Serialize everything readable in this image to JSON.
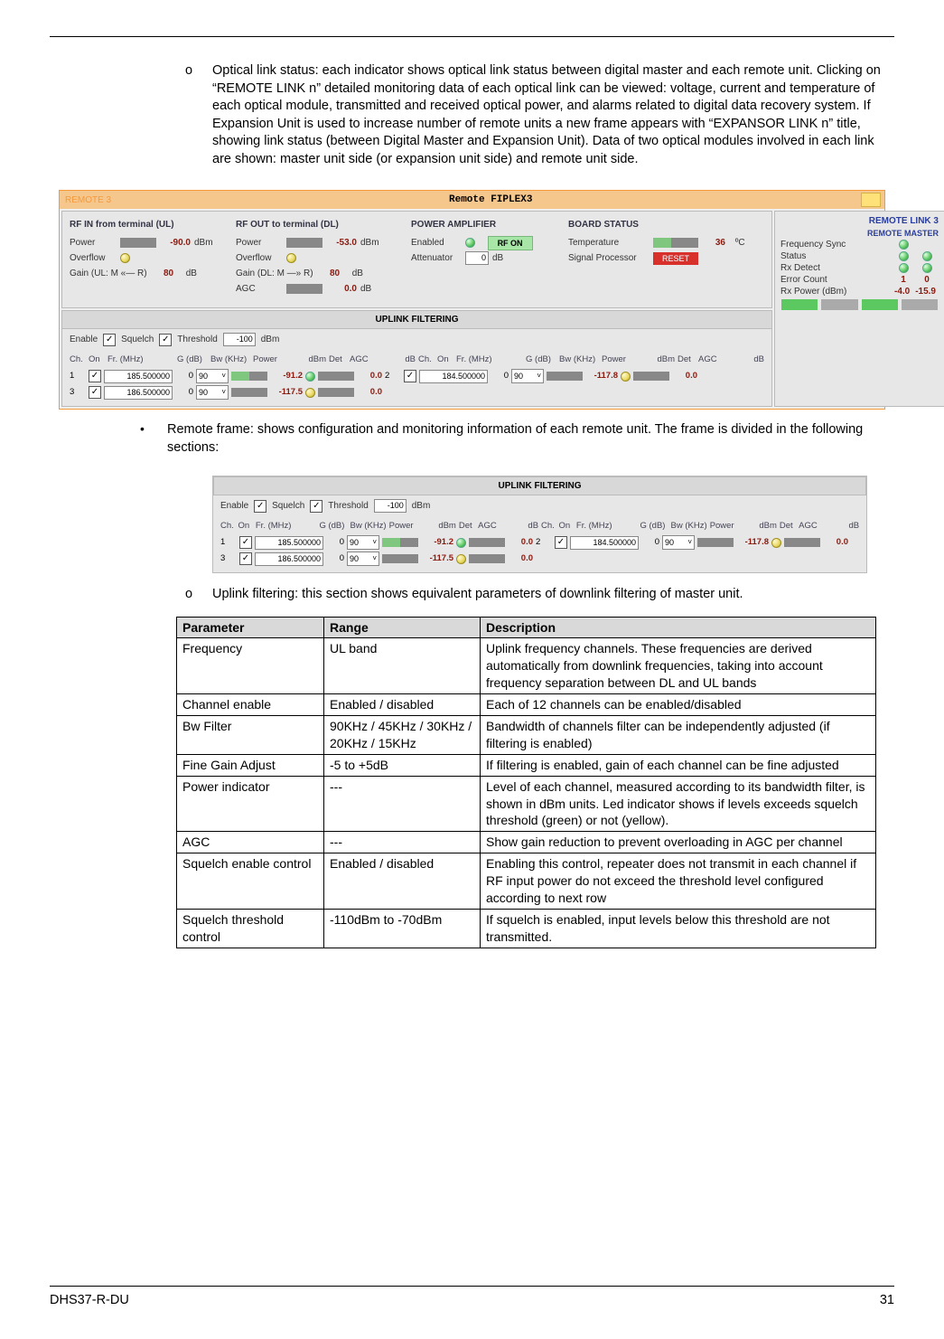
{
  "list1_marker": "o",
  "list1_text": "Optical link status: each indicator shows optical link status between digital master and each remote unit. Clicking on “REMOTE LINK n” detailed monitoring data of each optical link can be viewed: voltage, current and temperature of each optical module, transmitted and received optical power, and alarms related to digital data recovery system. If Expansion Unit is used to increase number of remote units a new frame appears with “EXPANSOR LINK n” title, showing link status (between Digital Master and Expansion Unit). Data of two optical modules involved in each link are shown: master unit side (or expansion unit side) and remote unit side.",
  "list2_marker": "•",
  "list2_text": "Remote frame: shows configuration and monitoring information of each remote unit. The frame is divided in the following sections:",
  "list3_marker": "o",
  "list3_text": "Uplink filtering: this section shows equivalent parameters of downlink filtering of master unit.",
  "fig1": {
    "tab": "REMOTE 3",
    "title": "Remote FIPLEX3",
    "ul": {
      "header": "RF IN from terminal (UL)",
      "power_lbl": "Power",
      "power_val": "-90.0",
      "power_unit": "dBm",
      "ovfl_lbl": "Overflow",
      "gain_lbl": "Gain (UL: M «— R)",
      "gain_val": "80",
      "gain_unit": "dB"
    },
    "dl": {
      "header": "RF OUT to terminal (DL)",
      "power_lbl": "Power",
      "power_val": "-53.0",
      "power_unit": "dBm",
      "ovfl_lbl": "Overflow",
      "gain_lbl": "Gain (DL: M —» R)",
      "gain_val": "80",
      "gain_unit": "dB",
      "agc_lbl": "AGC",
      "agc_val": "0.0",
      "agc_unit": "dB"
    },
    "pa": {
      "header": "POWER AMPLIFIER",
      "enabled_lbl": "Enabled",
      "rf_on": "RF ON",
      "att_lbl": "Attenuator",
      "att_val": "0",
      "att_unit": "dB"
    },
    "bs": {
      "header": "BOARD STATUS",
      "temp_lbl": "Temperature",
      "temp_val": "36",
      "temp_unit": "ºC",
      "sp_lbl": "Signal Processor",
      "reset": "RESET"
    },
    "uplink_title": "UPLINK FILTERING",
    "filter": {
      "enable_lbl": "Enable",
      "squelch_lbl": "Squelch",
      "thresh_lbl": "Threshold",
      "thresh_val": "-100",
      "thresh_unit": "dBm"
    },
    "ch_headers": [
      "Ch.",
      "On",
      "Fr. (MHz)",
      "G (dB)",
      "Bw (KHz)",
      "Power",
      "dBm",
      "Det",
      "AGC",
      "dB"
    ],
    "channels": [
      {
        "n": "1",
        "fr": "185.500000",
        "g": "0",
        "bw": "90",
        "dbm": "-91.2",
        "agc": "0.0"
      },
      {
        "n": "2",
        "fr": "184.500000",
        "g": "0",
        "bw": "90",
        "dbm": "-117.8",
        "agc": "0.0"
      },
      {
        "n": "3",
        "fr": "186.500000",
        "g": "0",
        "bw": "90",
        "dbm": "-117.5",
        "agc": "0.0"
      }
    ],
    "remote_link": {
      "title": "REMOTE LINK 3",
      "cols": "REMOTE MASTER",
      "rows": [
        {
          "lbl": "Frequency Sync"
        },
        {
          "lbl": "Status"
        },
        {
          "lbl": "Rx Detect"
        },
        {
          "lbl": "Error Count",
          "v1": "1",
          "v2": "0"
        },
        {
          "lbl": "Rx Power (dBm)",
          "v1": "-4.0",
          "v2": "-15.9"
        }
      ]
    }
  },
  "table": {
    "headers": [
      "Parameter",
      "Range",
      "Description"
    ],
    "rows": [
      [
        "Frequency",
        "UL band",
        "Uplink frequency channels. These frequencies are derived automatically from downlink frequencies, taking into account frequency separation between DL and UL bands"
      ],
      [
        "Channel enable",
        "Enabled / disabled",
        "Each of 12 channels can be enabled/disabled"
      ],
      [
        "Bw Filter",
        "90KHz / 45KHz / 30KHz / 20KHz / 15KHz",
        "Bandwidth of channels filter can be independently adjusted (if filtering is enabled)"
      ],
      [
        "Fine Gain Adjust",
        "-5 to +5dB",
        "If filtering is enabled, gain of each channel can be fine adjusted"
      ],
      [
        "Power indicator",
        "---",
        "Level of each channel, measured according to its bandwidth filter, is shown in dBm units. Led indicator shows if levels exceeds squelch threshold (green) or not (yellow)."
      ],
      [
        "AGC",
        "---",
        "Show gain reduction to prevent overloading in AGC per channel"
      ],
      [
        "Squelch enable control",
        "Enabled / disabled",
        "Enabling this control, repeater does not transmit in each channel if RF input power do not exceed the threshold level configured according to next row"
      ],
      [
        "Squelch threshold control",
        "-110dBm to -70dBm",
        "If squelch is enabled, input levels below this threshold are not transmitted."
      ]
    ]
  },
  "footer_left": "DHS37-R-DU",
  "footer_right": "31"
}
